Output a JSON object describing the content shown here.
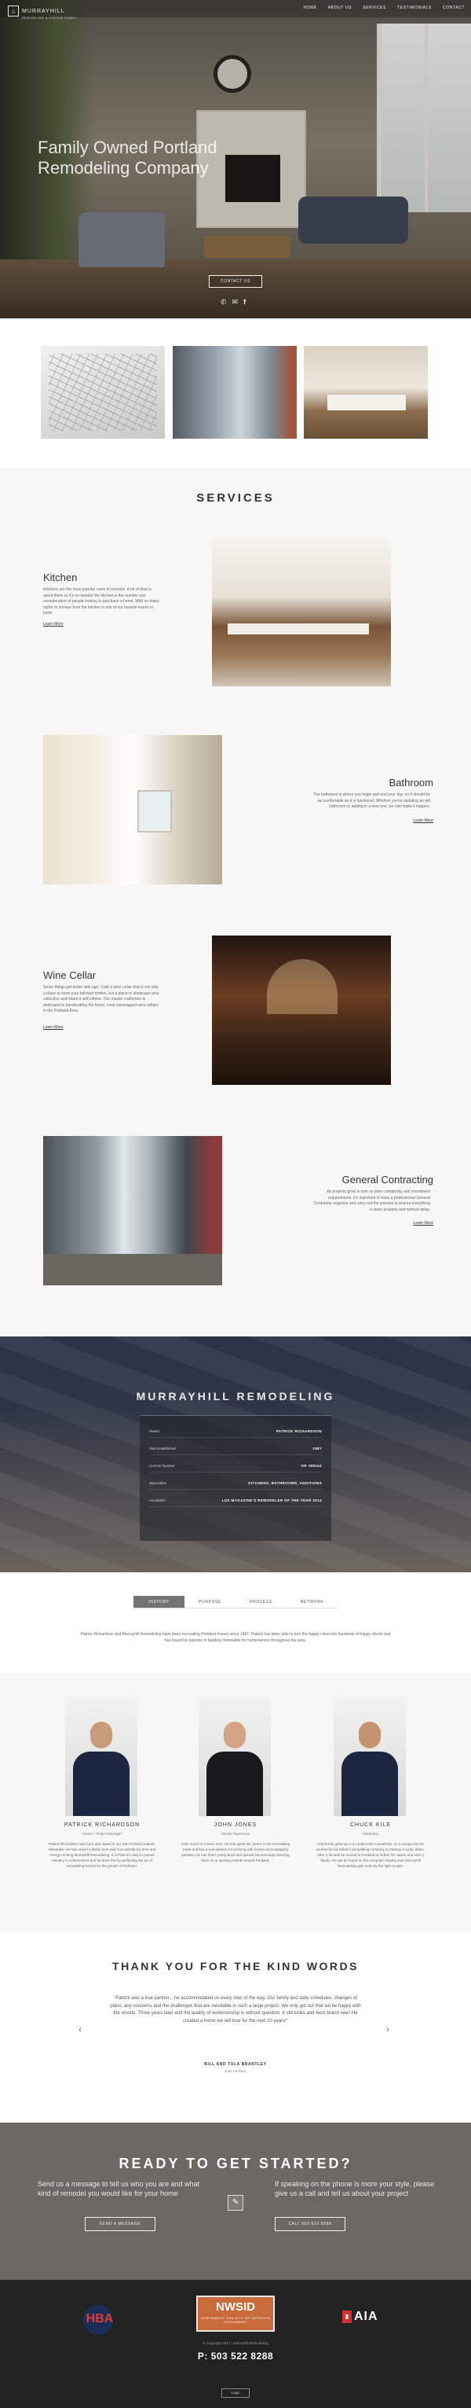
{
  "header": {
    "logo_name": "MURRAYHILL",
    "logo_sub": "REMODELING & CUSTOM HOMES",
    "nav": [
      "HOME",
      "ABOUT US",
      "SERVICES",
      "TESTIMONIALS",
      "CONTACT"
    ]
  },
  "hero": {
    "title": "Family Owned Portland Remodeling Company",
    "button": "CONTACT US"
  },
  "services": {
    "title": "SERVICES",
    "items": [
      {
        "heading": "Kitchen",
        "desc": "Kitchens are the most popular room to remodel. A lot of time is spent there so it's no wonder the kitchen is the number one consideration of people looking to purchase a home. With so many styles to choose from the kitchen is one of our favorite rooms to build.",
        "more": "Learn More"
      },
      {
        "heading": "Bathroom",
        "desc": "The bathroom is where you begin and end your day, so it should be as comfortable as it is functional. Whether you're updating an old bathroom or adding in a new one, we can make it happen.",
        "more": "Learn More"
      },
      {
        "heading": "Wine Cellar",
        "desc": "Some things get better with age. Craft a wine cellar that is not only a place to store your beloved bottles, but a place to showcase your collection and share it with others. Our master craftsmen is dedicated to handcrafting the finest, most extravagant wine cellars in the Portland Area.",
        "more": "Learn More"
      },
      {
        "heading": "General Contracting",
        "desc": "As projects grow in size so does complexity and investment requirements. It's important to have a professional General Contractor organize and carry out the process to ensure everything is done properly and without delay.",
        "more": "Learn More"
      }
    ]
  },
  "about": {
    "title": "MURRAYHILL REMODELING",
    "facts": [
      {
        "label": "Owner",
        "value": "PATRICK RICHARDSON"
      },
      {
        "label": "Year Established",
        "value": "1987"
      },
      {
        "label": "License Number",
        "value": "OR #85044"
      },
      {
        "label": "Specialties",
        "value": "KITCHENS, BATHROOMS, ADDITIONS"
      },
      {
        "label": "Accolades",
        "value": "LUX MAGAZINE'S REMODELER OF THE YEAR 2014"
      }
    ]
  },
  "tabs": {
    "items": [
      "HISTORY",
      "PURPOSE",
      "PROCESS",
      "NETWORK"
    ],
    "active_text": "Patrick Richardson and Murrayhill Remodeling have been renovating Portland homes since 1987. Patrick has been able to turn the happy client into hundreds of happy clients and has found his passion in building renewable for homeowners throughout the area."
  },
  "team": [
    {
      "name": "PATRICK RICHARDSON",
      "role": "Owner / Project Manager",
      "bio": "Patrick Richardson was born and raised in our own Portland suburb, Milwaukie. He has raised a family here and now spends his time and energy running Murrayhill Remodeling. It is Patrick's duty to pursue mastery in achievement and he does this by perfecting the art of remodeling homes for the people of Portland."
    },
    {
      "name": "JOHN JONES",
      "role": "Jobsite Supervisor",
      "bio": "John Jones is a team man. He has spent his career in the remodeling trade and has a real passion for working with homes and managing jobsites. He has three young boys and spends his evenings cheering them on at sporting events around Portland."
    },
    {
      "name": "CHUCK KILE",
      "role": "Marketing",
      "bio": "Chuck Kile grew up in a construction household. As a young man he worked for his father's remodeling company in Clatsop County, Idaho. After a decade he moved to Portland to further his career and start a family. He can be found on the computer making sure Murrayhill Remodeling gets seen by the right people."
    }
  ],
  "testimonials": {
    "title": "THANK YOU FOR THE KIND WORDS",
    "quote": "\"Patrick was a true partner... he accommodated us every step of the way. Our family and daily schedules, changes of plans, any concerns and the challenges that are inevitable in such a large project. We only got out that we be happy with the results. Three years later and the quality of workmanship is without question. It still looks and feels brand new! He created a home we will love for the next 20 years!\"",
    "author": "BILL AND TULA BRANTLEY",
    "location": "East Portland",
    "prev": "‹",
    "next": "›"
  },
  "cta": {
    "title": "READY TO GET STARTED?",
    "left_text": "Send us a message to tell us who you are and what kind of remodel you would like for your home",
    "right_text": "If speaking on the phone is more your style, please give us a call and tell us about your project",
    "left_button": "SEND A MESSAGE",
    "right_button": "CALL 503-522-8288"
  },
  "footer": {
    "hba": "HBA",
    "nwsid_title": "NWSID",
    "nwsid_sub": "NORTHWEST SOCIETY OF INTERIOR DESIGNERS",
    "aia": "AIA",
    "copyright": "© Copyright 2017 · Murrayhill Remodeling",
    "phone": "P: 503 522 8288",
    "login": "Login"
  },
  "icons": [
    "phone-icon",
    "email-icon",
    "facebook-icon",
    "contact-icon"
  ]
}
